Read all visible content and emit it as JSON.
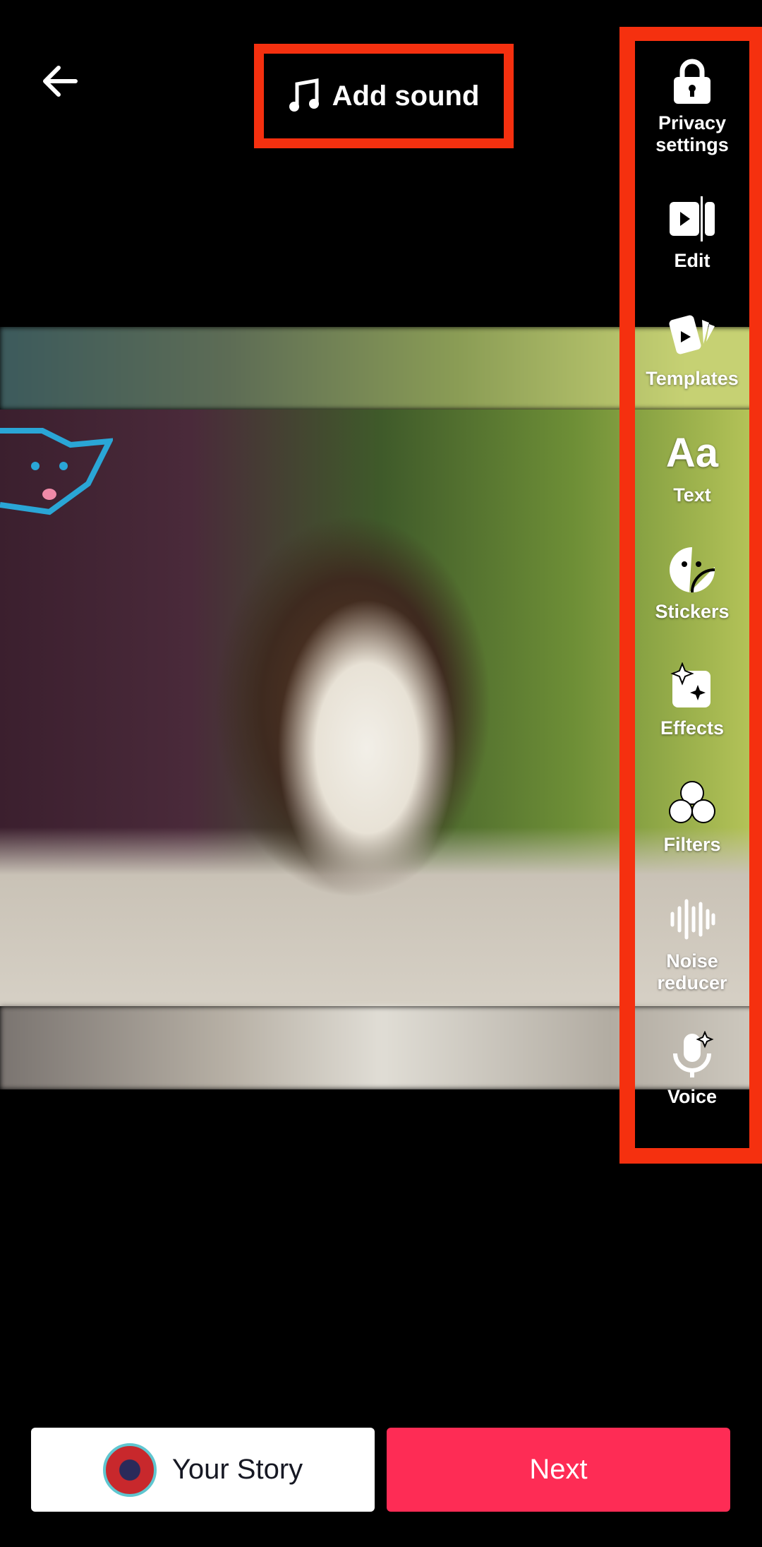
{
  "header": {
    "back_icon": "arrow-left-icon",
    "sound_icon": "music-note-icon",
    "add_sound_label": "Add sound"
  },
  "sidebar": {
    "items": [
      {
        "label": "Privacy settings",
        "icon": "lock-icon"
      },
      {
        "label": "Edit",
        "icon": "edit-clip-icon"
      },
      {
        "label": "Templates",
        "icon": "templates-icon"
      },
      {
        "label": "Text",
        "icon": "text-aa-icon"
      },
      {
        "label": "Stickers",
        "icon": "sticker-icon"
      },
      {
        "label": "Effects",
        "icon": "effects-icon"
      },
      {
        "label": "Filters",
        "icon": "filters-icon"
      },
      {
        "label": "Noise reducer",
        "icon": "waveform-icon"
      },
      {
        "label": "Voice",
        "icon": "voice-mic-icon"
      }
    ]
  },
  "text_glyph": "Aa",
  "footer": {
    "your_story_label": "Your Story",
    "next_label": "Next"
  },
  "colors": {
    "highlight": "#f5300f",
    "next": "#fe2c55"
  }
}
